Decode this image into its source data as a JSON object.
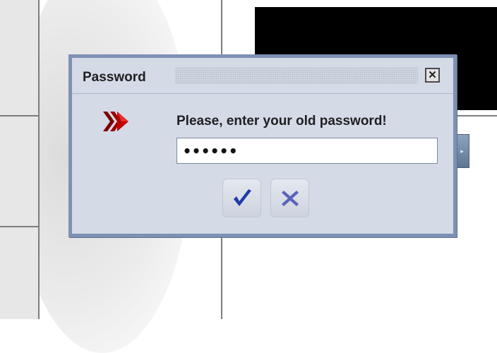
{
  "dialog": {
    "title": "Password",
    "message": "Please, enter your old password!",
    "password_value": "******",
    "close_icon": "close-icon",
    "ok_icon": "checkmark-icon",
    "cancel_icon": "x-icon",
    "arrows_icon": "triple-arrow-right-icon"
  },
  "colors": {
    "dialog_border": "#7d91b4",
    "dialog_background": "#d4dae6",
    "arrow_red": "#b00000",
    "checkmark_blue": "#1f3ca8",
    "x_blue": "#5b62b8"
  }
}
